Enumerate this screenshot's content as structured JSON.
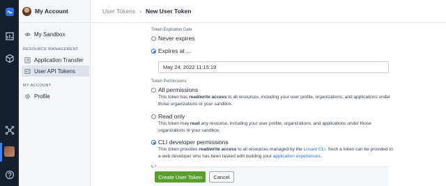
{
  "breadcrumb": {
    "parent": "User Tokens",
    "separator": "›",
    "current": "New User Token"
  },
  "sidebar": {
    "account_label": "My Account",
    "sandbox_label": "My Sandbox",
    "sections": [
      {
        "heading": "RESOURCE MANAGEMENT",
        "items": [
          {
            "label": "Application Transfer",
            "icon": "transfer-icon"
          },
          {
            "label": "User API Tokens",
            "icon": "token-icon",
            "active": true
          }
        ]
      },
      {
        "heading": "MY ACCOUNT",
        "items": [
          {
            "label": "Profile",
            "icon": "gear-icon"
          }
        ]
      }
    ]
  },
  "rail": {
    "icons": [
      "losant-logo-icon",
      "dashboard-icon",
      "cube-icon",
      "network-icon",
      "user-avatar-icon",
      "help-icon"
    ],
    "accent": "#3b82f6"
  },
  "form": {
    "expiration": {
      "label": "Token Expiration Date",
      "options": [
        {
          "label": "Never expires",
          "checked": false
        },
        {
          "label": "Expires at ...",
          "checked": true
        }
      ],
      "date_value": "May 24, 2022 11:15:19"
    },
    "permissions": {
      "label": "Token Permissions",
      "options": [
        {
          "label": "All permissions",
          "checked": false,
          "desc_pre": "This token has ",
          "desc_bold": "read/write access",
          "desc_post": " to all resources, including your user profile, organizations, and applications under those organizations or your sandbox."
        },
        {
          "label": "Read only",
          "checked": false,
          "desc_pre": "This token may ",
          "desc_bold": "read",
          "desc_post": " any resource, including your user profile, organizations, and applications under those organizations or your sandbox."
        },
        {
          "label": "CLI developer permissions",
          "checked": true,
          "desc_pre": "This token provides ",
          "desc_bold": "read/write access",
          "desc_mid": " to all resources managed by the ",
          "desc_link1": "Losant CLI",
          "desc_mid2": ". Such a token can be provided to a web developer who has been tasked with building your ",
          "desc_link2": "application experiences",
          "desc_post": "."
        }
      ]
    }
  },
  "actions": {
    "create_label": "Create User Token",
    "cancel_label": "Cancel",
    "create_color": "#5a9f2c"
  }
}
